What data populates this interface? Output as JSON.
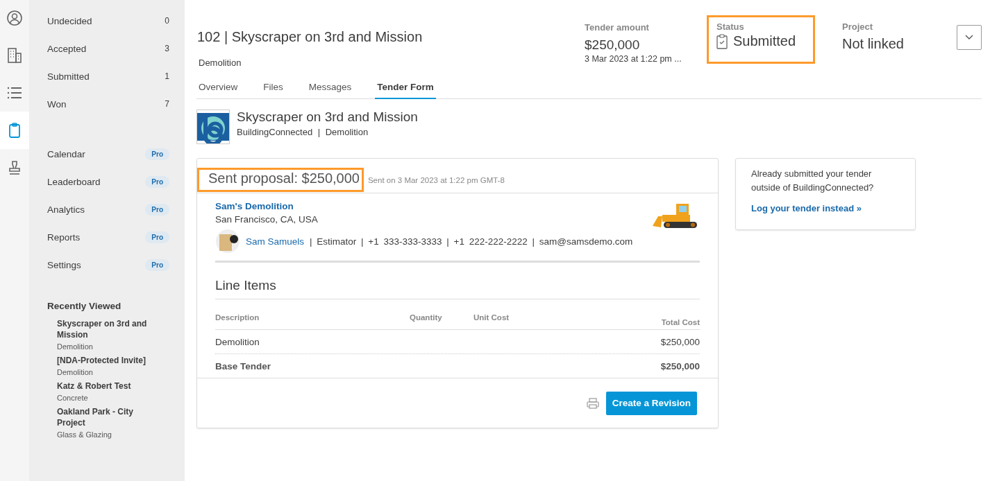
{
  "rail": [
    {
      "selected": false
    },
    {
      "selected": false
    },
    {
      "selected": false
    },
    {
      "selected": true
    },
    {
      "selected": false
    }
  ],
  "sidebar": {
    "status_items": [
      {
        "label": "Undecided",
        "count": "0"
      },
      {
        "label": "Accepted",
        "count": "3"
      },
      {
        "label": "Submitted",
        "count": "1"
      },
      {
        "label": "Won",
        "count": "7"
      }
    ],
    "pro_items": [
      {
        "label": "Calendar",
        "badge": "Pro"
      },
      {
        "label": "Leaderboard",
        "badge": "Pro"
      },
      {
        "label": "Analytics",
        "badge": "Pro"
      },
      {
        "label": "Reports",
        "badge": "Pro"
      },
      {
        "label": "Settings",
        "badge": "Pro"
      }
    ],
    "recently_viewed": {
      "title": "Recently Viewed",
      "items": [
        {
          "name": "Skyscraper on 3rd and Mission",
          "trade": "Demolition"
        },
        {
          "name": "[NDA-Protected Invite]",
          "trade": "Demolition"
        },
        {
          "name": "Katz & Robert Test",
          "trade": "Concrete"
        },
        {
          "name": "Oakland Park - City Project",
          "trade": "Glass & Glazing"
        }
      ]
    }
  },
  "header": {
    "title": "102 | Skyscraper on 3rd and Mission",
    "subtitle": "Demolition",
    "tender_amount": {
      "label": "Tender amount",
      "value": "$250,000",
      "date": "3 Mar 2023 at 1:22 pm ..."
    },
    "status": {
      "label": "Status",
      "value": "Submitted",
      "highlighted": true
    },
    "project": {
      "label": "Project",
      "value": "Not linked"
    }
  },
  "tabs": [
    {
      "label": "Overview",
      "selected": false
    },
    {
      "label": "Files",
      "selected": false
    },
    {
      "label": "Messages",
      "selected": false
    },
    {
      "label": "Tender Form",
      "selected": true
    }
  ],
  "project_info": {
    "name": "Skyscraper on 3rd and Mission",
    "meta": "BuildingConnected | Demolition"
  },
  "proposal": {
    "title": "Sent proposal: $250,000",
    "highlighted": true,
    "sent_on": "Sent on 3 Mar 2023 at 1:22 pm GMT-8",
    "company": "Sam's Demolition",
    "location": "San Francisco, CA, USA",
    "contact": {
      "name": "Sam Samuels",
      "details": "| Estimator | +1 333-333-3333 | +1 222-222-2222 | sam@samsdemo.com"
    },
    "line_items_title": "Line Items",
    "columns": [
      "Description",
      "Quantity",
      "Unit Cost",
      "Total Cost"
    ],
    "rows": [
      {
        "description": "Demolition",
        "total": "$250,000",
        "bold": false
      },
      {
        "description": "Base Tender",
        "total": "$250,000",
        "bold": true
      }
    ],
    "button": "Create a Revision"
  },
  "side_card": {
    "text": "Already submitted your tender outside of BuildingConnected?",
    "link": "Log your tender instead »"
  }
}
